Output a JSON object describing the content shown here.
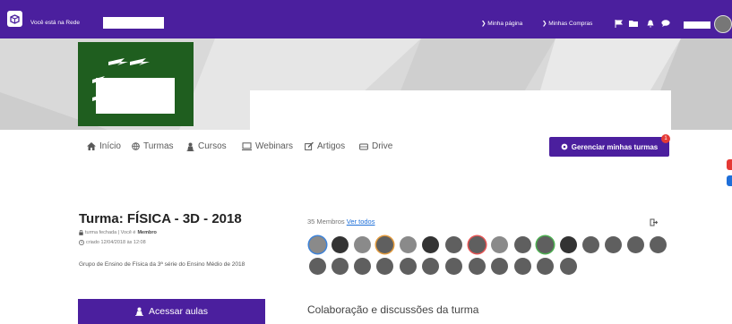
{
  "topbar": {
    "network_text": "Você está na Rede",
    "links": [
      "❯ Minha página",
      "❯ Minhas Compras"
    ],
    "icons": [
      "flag-icon",
      "folder-icon",
      "bell-icon",
      "chat-icon"
    ]
  },
  "nav": {
    "items": [
      {
        "label": "Início",
        "icon": "home-icon"
      },
      {
        "label": "Turmas",
        "icon": "globe-icon"
      },
      {
        "label": "Cursos",
        "icon": "person-icon"
      },
      {
        "label": "Webinars",
        "icon": "monitor-icon"
      },
      {
        "label": "Artigos",
        "icon": "edit-icon"
      },
      {
        "label": "Drive",
        "icon": "drive-icon"
      }
    ],
    "manage_label": "Gerenciar minhas turmas",
    "manage_badge": "1"
  },
  "class": {
    "title": "Turma: FÍSICA - 3D - 2018",
    "status_prefix": "turma fechada | Você é",
    "status_role": "Membro",
    "created": "criado 12/04/2018 às 12:08",
    "description": "Grupo de Ensino de Física da 3ª série do Ensino Médio de 2018",
    "access_label": "Acessar aulas"
  },
  "members": {
    "count_label": "35 Membros",
    "see_all_label": "Ver todos"
  },
  "collab": {
    "title": "Colaboração e discussões da turma"
  },
  "colors": {
    "brand": "#4b1f9e",
    "logo_green": "#1f5e1f",
    "badge": "#e53935",
    "link": "#1e6fd9"
  }
}
